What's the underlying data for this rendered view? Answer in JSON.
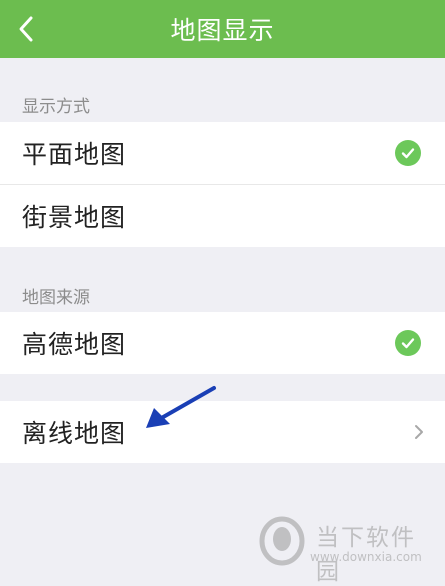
{
  "header": {
    "title": "地图显示"
  },
  "sections": [
    {
      "label": "显示方式",
      "items": [
        {
          "label": "平面地图",
          "selected": true
        },
        {
          "label": "街景地图",
          "selected": false
        }
      ]
    },
    {
      "label": "地图来源",
      "items": [
        {
          "label": "高德地图",
          "selected": true
        }
      ]
    }
  ],
  "offline": {
    "label": "离线地图",
    "icon": "chevron-right-icon"
  },
  "watermark": {
    "name": "当下软件园",
    "url": "www.downxia.com"
  },
  "colors": {
    "accent": "#6cbd4f",
    "check": "#6cc85a",
    "annotation_arrow": "#1a3fb5"
  }
}
